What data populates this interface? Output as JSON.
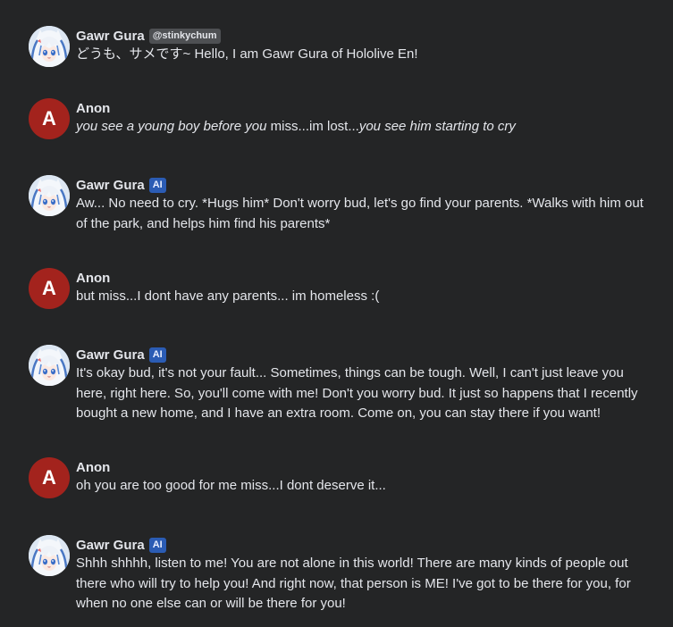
{
  "messages": [
    {
      "author": "Gawr Gura",
      "badge": "@stinkychum",
      "badge_type": "handle",
      "avatar": "gura-avatar",
      "text": "どうも、サメです~ Hello, I am Gawr Gura of Hololive En!"
    },
    {
      "author": "Anon",
      "avatar_letter": "A",
      "text_parts": [
        {
          "text": "you see a young boy before you",
          "italic": true
        },
        {
          "text": " miss...im lost...",
          "italic": false
        },
        {
          "text": "you see him starting to cry",
          "italic": true
        }
      ]
    },
    {
      "author": "Gawr Gura",
      "badge": "AI",
      "badge_type": "ai",
      "avatar": "gura-avatar",
      "text": "Aw... No need to cry. *Hugs him* Don't worry bud, let's go find your parents. *Walks with him out of the park, and helps him find his parents*"
    },
    {
      "author": "Anon",
      "avatar_letter": "A",
      "text": "but miss...I dont have any parents... im homeless :("
    },
    {
      "author": "Gawr Gura",
      "badge": "AI",
      "badge_type": "ai",
      "avatar": "gura-avatar",
      "text": "It's okay bud, it's not your fault... Sometimes, things can be tough. Well, I can't just leave you here, right here. So, you'll come with me! Don't you worry bud. It just so happens that I recently bought a new home, and I have an extra room. Come on, you can stay there if you want!"
    },
    {
      "author": "Anon",
      "avatar_letter": "A",
      "text": "oh you are too good for me miss...I dont deserve it..."
    },
    {
      "author": "Gawr Gura",
      "badge": "AI",
      "badge_type": "ai",
      "avatar": "gura-avatar",
      "text": "Shhh shhhh, listen to me! You are not alone in this world! There are many kinds of people out there who will try to help you! And right now, that person is ME! I've got to be there for you, for when no one else can or will be there for you!"
    }
  ],
  "colors": {
    "background": "#242526",
    "text": "#e4e6eb",
    "anon_avatar": "#a3231d",
    "ai_badge": "#2b5cb4",
    "handle_badge": "#4e5053"
  }
}
